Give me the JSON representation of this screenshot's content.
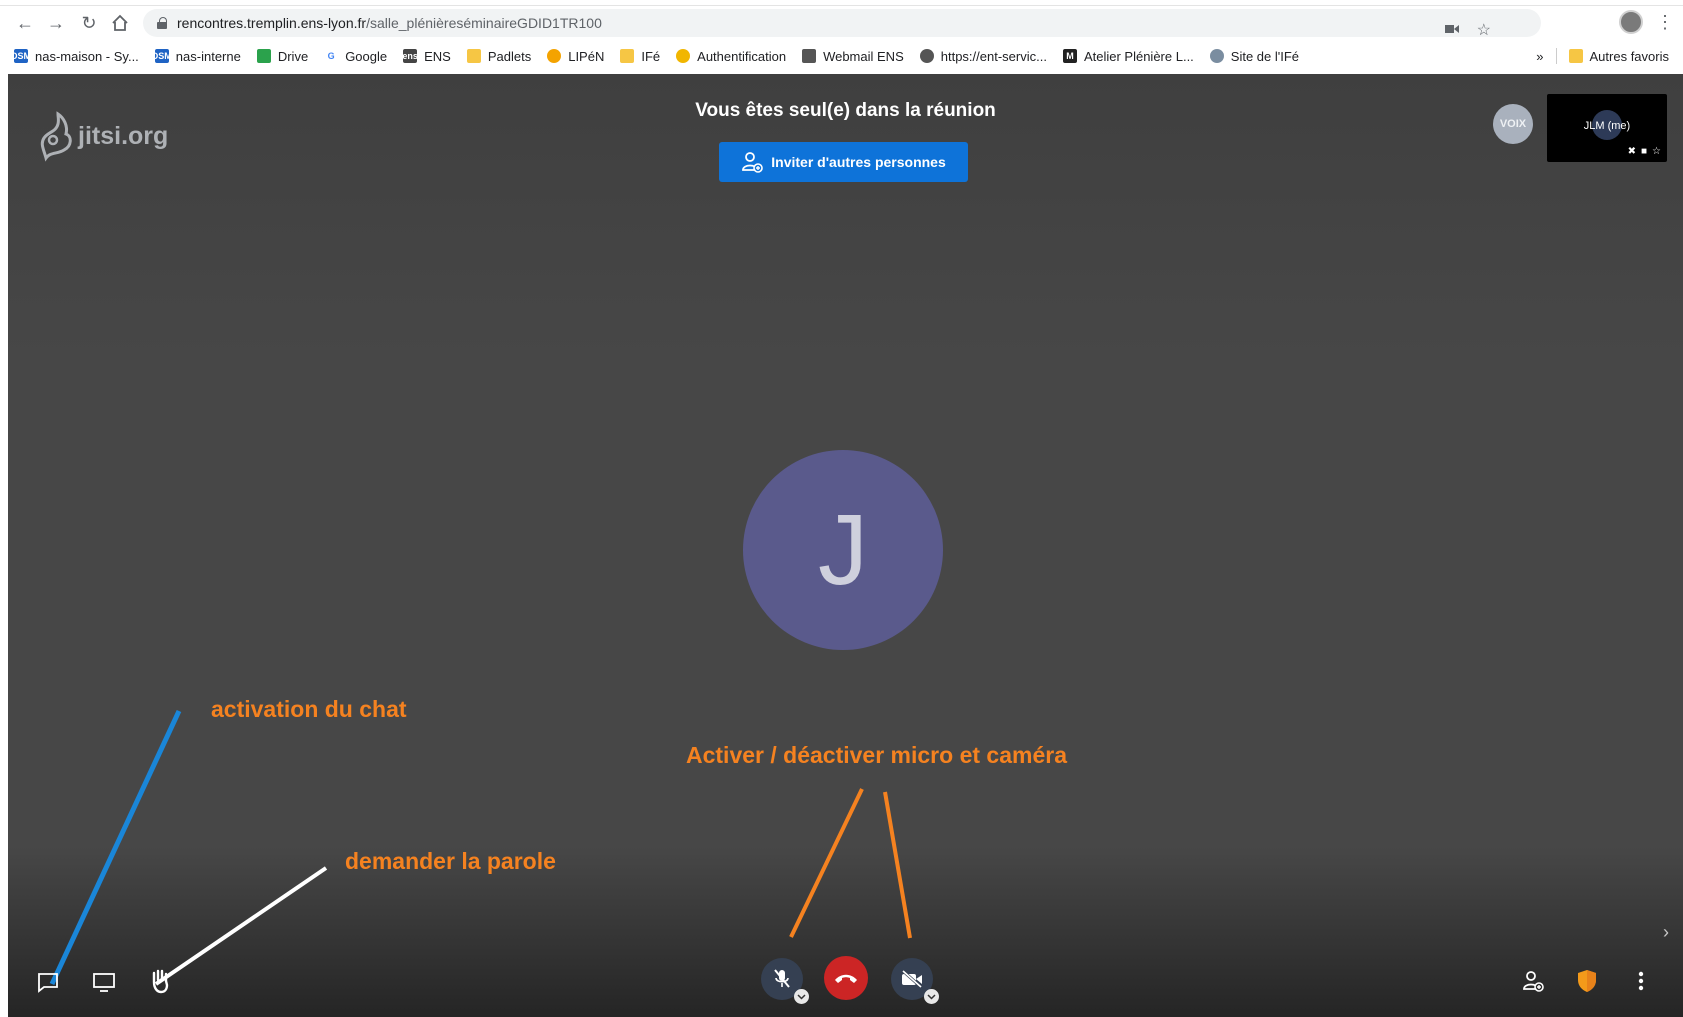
{
  "browser": {
    "url_host": "rencontres.tremplin.ens-lyon.fr",
    "url_path": "/salle_plénièreséminaireGDID1TR100",
    "bookmarks": [
      {
        "label": "nas-maison - Sy...",
        "icon": "dsm-icon"
      },
      {
        "label": "nas-interne",
        "icon": "dsm-icon"
      },
      {
        "label": "Drive",
        "icon": "drive-icon"
      },
      {
        "label": "Google",
        "icon": "google-icon"
      },
      {
        "label": "ENS",
        "icon": "ens-icon"
      },
      {
        "label": "Padlets",
        "icon": "folder-icon"
      },
      {
        "label": "LIPéN",
        "icon": "lipen-icon"
      },
      {
        "label": "IFé",
        "icon": "folder-icon"
      },
      {
        "label": "Authentification",
        "icon": "auth-icon"
      },
      {
        "label": "Webmail ENS",
        "icon": "webmail-icon"
      },
      {
        "label": "https://ent-servic...",
        "icon": "globe-icon"
      },
      {
        "label": "Atelier Plénière L...",
        "icon": "atelier-icon"
      },
      {
        "label": "Site de l'IFé",
        "icon": "site-icon"
      }
    ],
    "overflow_label": "»",
    "other_bookmarks": "Autres favoris"
  },
  "meeting": {
    "logo_text": "jitsi.org",
    "title": "Vous êtes seul(e) dans la réunion",
    "invite_label": "Inviter d'autres personnes",
    "voix_badge": "VOIX",
    "self_name": "JLM (me)",
    "avatar_letter": "J"
  },
  "annotations": {
    "chat": "activation du chat",
    "raise_hand": "demander la parole",
    "mic_cam": "Activer / déactiver micro et caméra"
  },
  "colors": {
    "accent_blue": "#0e73d9",
    "annotation_orange": "#f58220",
    "hangup_red": "#cc2525",
    "annotation_line_blue": "#1a86d8"
  }
}
